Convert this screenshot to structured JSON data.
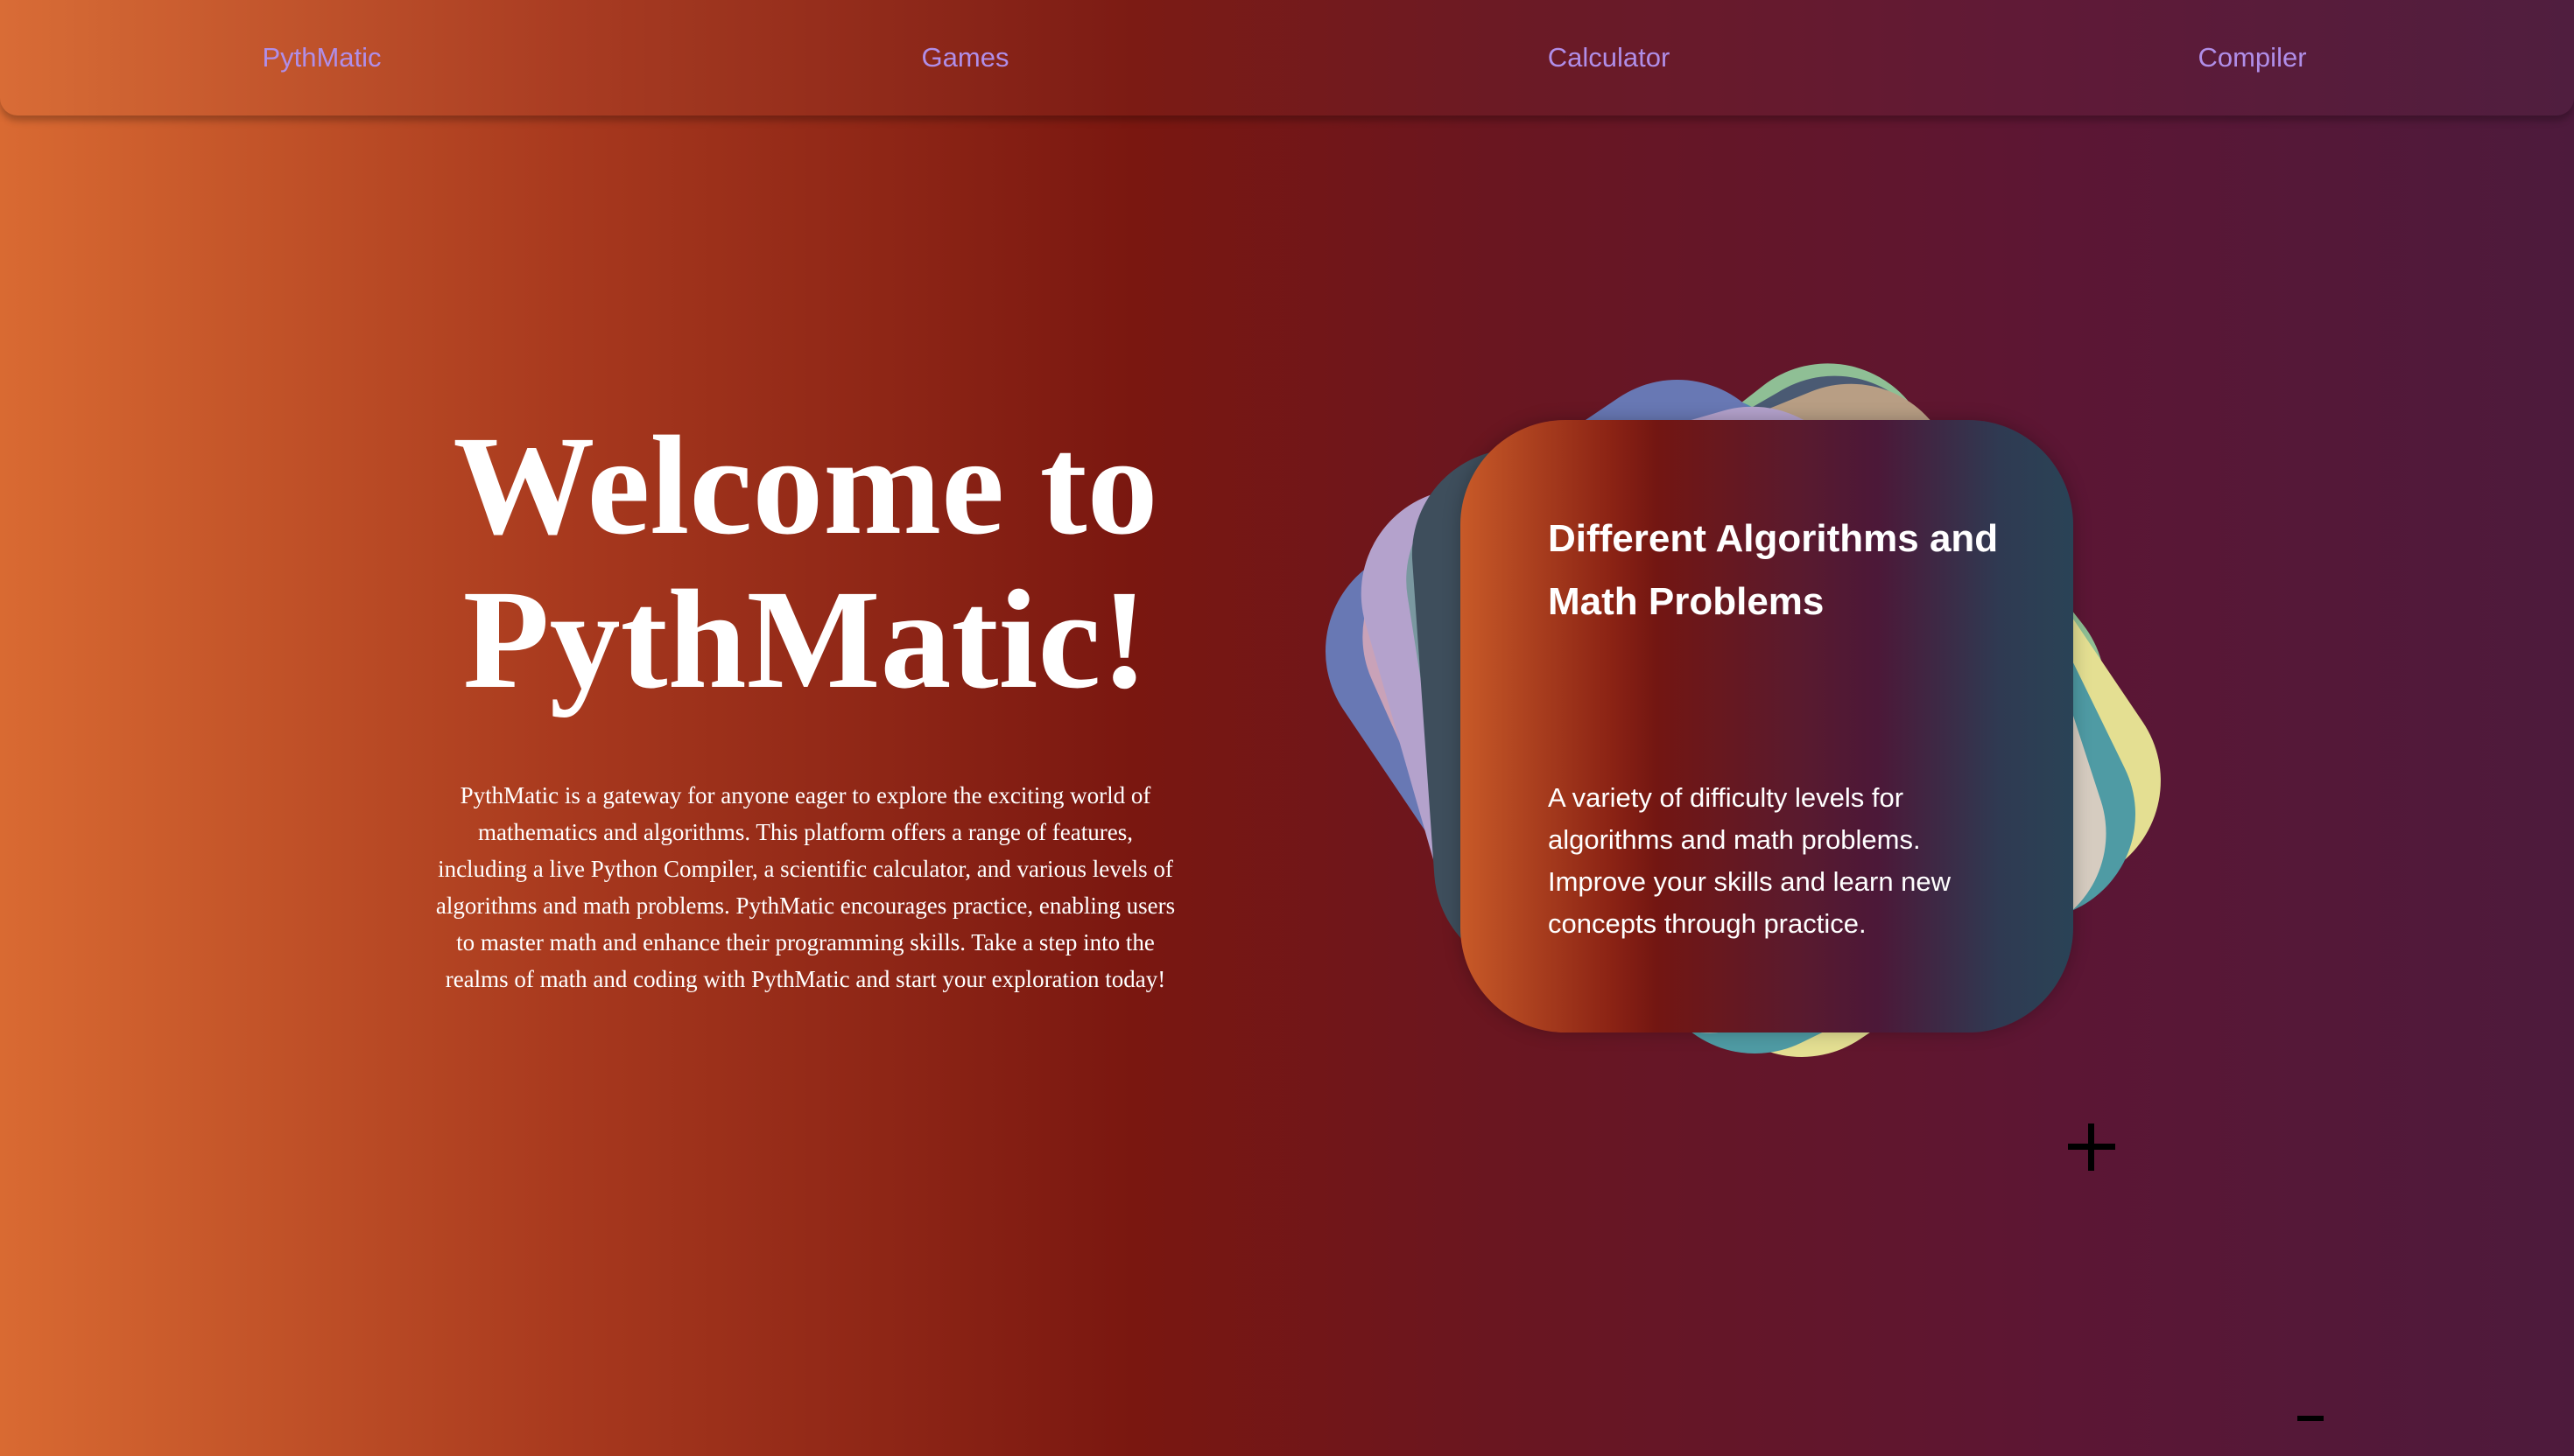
{
  "nav": {
    "items": [
      {
        "label": "PythMatic"
      },
      {
        "label": "Games"
      },
      {
        "label": "Calculator"
      },
      {
        "label": "Compiler"
      }
    ],
    "link_color": "#b08ee8"
  },
  "hero": {
    "title_line1": "Welcome to",
    "title_line2": "PythMatic!",
    "description": "PythMatic is a gateway for anyone eager to explore the exciting world of mathematics and algorithms. This platform offers a range of features, including a live Python Compiler, a scientific calculator, and various levels of algorithms and math problems. PythMatic encourages practice, enabling users to master math and enhance their programming skills. Take a step into the realms of math and coding with PythMatic and start your exploration today!"
  },
  "card": {
    "title": "Different Algorithms and Math Problems",
    "text": "A variety of difficulty levels for algorithms and math problems. Improve your skills and learn new concepts through practice."
  },
  "controls": {
    "plus_icon": "plus-icon",
    "minus_icon": "minus-icon"
  },
  "colors": {
    "background_start": "#d96a32",
    "background_mid": "#7a1710",
    "background_end": "#4d1a3c",
    "stack_colors": [
      "#8fbf95",
      "#4a5a73",
      "#b89e84",
      "#e4df92",
      "#4f9ba4",
      "#d6ccc0",
      "#4e8ab0",
      "#c9a2b8",
      "#7a98a0",
      "#6878b4",
      "#b4a2cc",
      "#3e4e5c"
    ]
  }
}
